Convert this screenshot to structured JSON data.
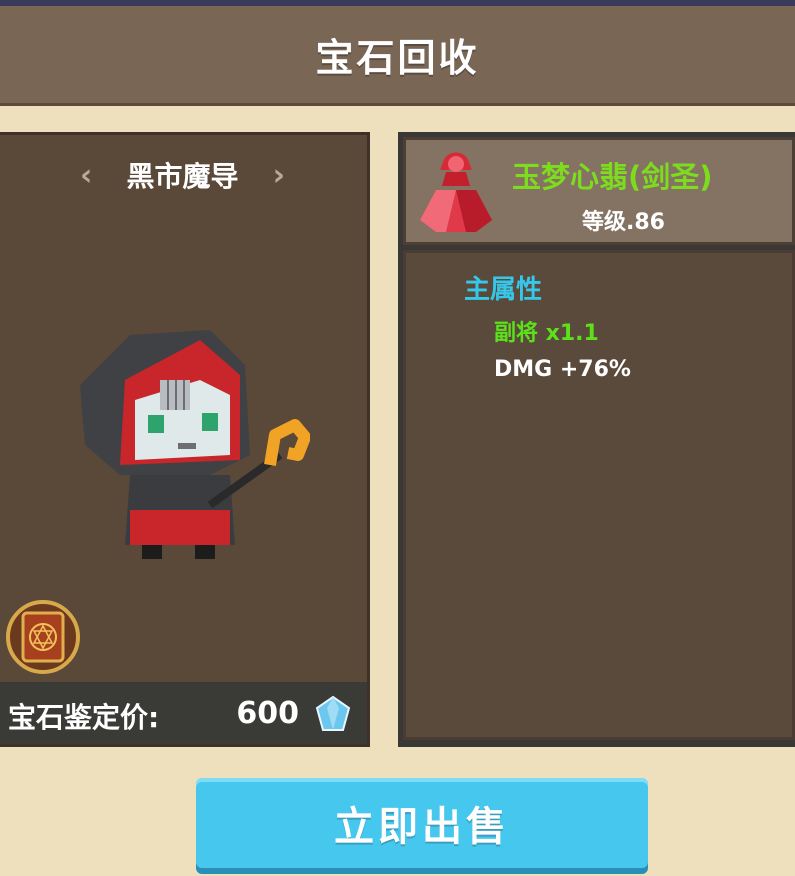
{
  "header": {
    "title": "宝石回收"
  },
  "npc": {
    "name": "黑市魔导",
    "prev_arrow": "‹",
    "next_arrow": "›"
  },
  "price": {
    "label": "宝石鉴定价:",
    "value": "600",
    "currency_icon": "diamond-icon"
  },
  "gem": {
    "name": "玉梦心翡(剑圣)",
    "level": "等级.86",
    "icon": "red-gem-icon"
  },
  "attributes": {
    "heading": "主属性",
    "lines": [
      "副将 x1.1",
      "DMG +76%"
    ]
  },
  "actions": {
    "sell_label": "立即出售"
  },
  "colors": {
    "title_bar": "#7a6655",
    "gem_name": "#7ddc1e",
    "attr_heading": "#35c8ea",
    "attr_green": "#5ce01a",
    "sell_button": "#46c7ee"
  }
}
